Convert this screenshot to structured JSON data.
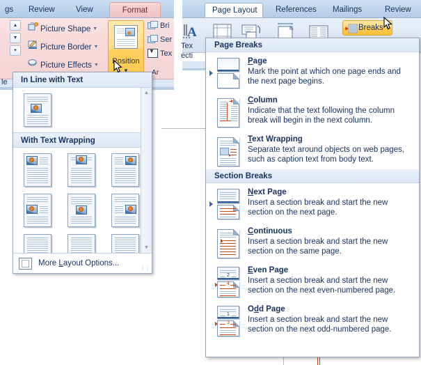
{
  "left_ribbon": {
    "tabs": [
      {
        "label": "gs",
        "active": false
      },
      {
        "label": "Review",
        "active": false
      },
      {
        "label": "View",
        "active": false
      },
      {
        "label": "Format",
        "active": true
      }
    ],
    "commands": [
      {
        "label": "Picture Shape",
        "icon": "picture-shape-icon",
        "has_arrow": true
      },
      {
        "label": "Picture Border",
        "icon": "picture-border-icon",
        "has_arrow": true
      },
      {
        "label": "Picture Effects",
        "icon": "picture-effects-icon",
        "has_arrow": true
      }
    ],
    "position_button": {
      "label": "Position",
      "icon": "position-icon",
      "dropdown_arrow": "▼"
    },
    "arrange_commands": [
      {
        "label": "Bri",
        "icon": "bring-to-front-icon"
      },
      {
        "label": "Ser",
        "icon": "send-to-back-icon"
      },
      {
        "label": "Tex",
        "icon": "text-wrapping-icon"
      }
    ],
    "group_label": "Ar",
    "left_edge_label": "le"
  },
  "position_gallery": {
    "sections": [
      {
        "header": "In Line with Text",
        "rows": [
          [
            {
              "name": "in-line-with-text",
              "layout": "inline"
            }
          ]
        ]
      },
      {
        "header": "With Text Wrapping",
        "rows": [
          [
            {
              "name": "square-top-left",
              "layout": "top-left"
            },
            {
              "name": "square-top-center",
              "layout": "top-center"
            },
            {
              "name": "square-top-right",
              "layout": "top-right"
            }
          ],
          [
            {
              "name": "square-middle-left",
              "layout": "middle-left"
            },
            {
              "name": "square-middle-center",
              "layout": "middle-center"
            },
            {
              "name": "square-middle-right",
              "layout": "middle-right"
            }
          ],
          [
            {
              "name": "square-bottom-left",
              "layout": "bottom-left"
            },
            {
              "name": "square-bottom-center",
              "layout": "bottom-center"
            },
            {
              "name": "square-bottom-right",
              "layout": "bottom-right"
            }
          ]
        ]
      }
    ],
    "scroll_up": "▲",
    "scroll_down": "▼",
    "footer": {
      "label_pre": "More ",
      "label_key": "L",
      "label_post": "ayout Options...",
      "icon": "layout-options-icon"
    }
  },
  "right_ribbon": {
    "tabs": [
      {
        "label": "Page Layout",
        "active": true
      },
      {
        "label": "References",
        "active": false
      },
      {
        "label": "Mailings",
        "active": false
      },
      {
        "label": "Review",
        "active": false
      }
    ],
    "icons": [
      {
        "name": "drop-cap-icon"
      },
      {
        "name": "margins-icon"
      },
      {
        "name": "orientation-icon"
      },
      {
        "name": "size-icon"
      },
      {
        "name": "columns-icon"
      }
    ],
    "breaks_button": {
      "label": "Breaks",
      "caret": "▼",
      "icon": "breaks-icon"
    },
    "left_labels": [
      "Tex",
      "ecti"
    ]
  },
  "breaks_menu": {
    "sections": [
      {
        "header": "Page Breaks",
        "items": [
          {
            "title_pre": "",
            "title_key": "P",
            "title_post": "age",
            "title_full": "Page",
            "desc": "Mark the point at which one page ends and the next page begins.",
            "icon": "page-break-icon",
            "highlighted": true
          },
          {
            "title_pre": "",
            "title_key": "C",
            "title_post": "olumn",
            "title_full": "Column",
            "desc": "Indicate that the text following the column break will begin in the next column.",
            "icon": "column-break-icon",
            "highlighted": false
          },
          {
            "title_pre": "",
            "title_key": "T",
            "title_post": "ext Wrapping",
            "title_full": "Text Wrapping",
            "desc": "Separate text around objects on web pages, such as caption text from body text.",
            "icon": "text-wrapping-break-icon",
            "highlighted": false
          }
        ]
      },
      {
        "header": "Section Breaks",
        "items": [
          {
            "title_pre": "",
            "title_key": "N",
            "title_post": "ext Page",
            "title_full": "Next Page",
            "desc": "Insert a section break and start the new section on the next page.",
            "icon": "next-page-break-icon",
            "highlighted": true
          },
          {
            "title_pre": "",
            "title_key": "C",
            "title_post": "ontinuous",
            "title_full": "Continuous",
            "desc": "Insert a section break and start the new section on the same page.",
            "icon": "continuous-break-icon",
            "highlighted": false
          },
          {
            "title_pre": "",
            "title_key": "E",
            "title_post": "ven Page",
            "title_full": "Even Page",
            "desc": "Insert a section break and start the new section on the next even-numbered page.",
            "icon": "even-page-break-icon",
            "highlighted": false,
            "page_numbers": [
              "2",
              "4"
            ]
          },
          {
            "title_pre": "O",
            "title_key": "d",
            "title_post": "d Page",
            "title_full": "Odd Page",
            "desc": "Insert a section break and start the new section on the next odd-numbered page.",
            "icon": "odd-page-break-icon",
            "highlighted": false,
            "page_numbers": [
              "1",
              "3"
            ]
          }
        ]
      }
    ]
  },
  "colors": {
    "accent_orange": "#ffc84c",
    "ribbon_blue": "#bed4ec",
    "format_tab_pink": "#f3caca",
    "menu_text": "#1b3461",
    "break_red": "#c8441a"
  }
}
